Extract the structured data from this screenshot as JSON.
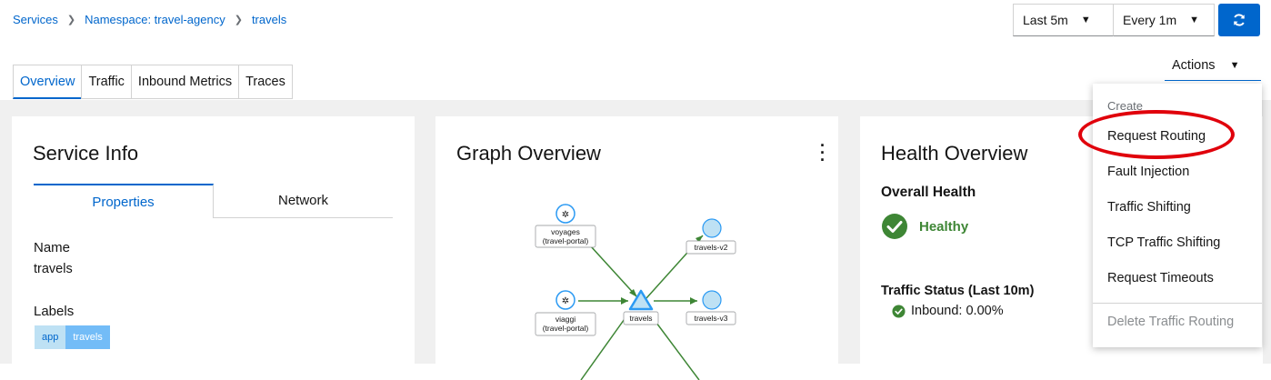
{
  "breadcrumb": {
    "items": [
      "Services",
      "Namespace: travel-agency",
      "travels"
    ]
  },
  "time_controls": {
    "range": "Last 5m",
    "refresh_interval": "Every 1m",
    "refresh_icon": "sync-icon"
  },
  "tabs": [
    "Overview",
    "Traffic",
    "Inbound Metrics",
    "Traces"
  ],
  "actions": {
    "label": "Actions",
    "menu": {
      "group": "Create",
      "items": [
        "Request Routing",
        "Fault Injection",
        "Traffic Shifting",
        "TCP Traffic Shifting",
        "Request Timeouts"
      ],
      "disabled_item": "Delete Traffic Routing"
    }
  },
  "service_info": {
    "title": "Service Info",
    "tabs": [
      "Properties",
      "Network"
    ],
    "name_label": "Name",
    "name_value": "travels",
    "labels_label": "Labels",
    "label_key": "app",
    "label_value": "travels"
  },
  "graph_overview": {
    "title": "Graph Overview",
    "nodes": {
      "voyages": [
        "voyages",
        "(travel-portal)"
      ],
      "viaggi": [
        "viaggi",
        "(travel-portal)"
      ],
      "travels": "travels",
      "travels_v2": "travels-v2",
      "travels_v3": "travels-v3"
    }
  },
  "health_overview": {
    "title": "Health Overview",
    "overall_label": "Overall Health",
    "status": "Healthy",
    "traffic_status_label": "Traffic Status (Last 10m)",
    "inbound": "Inbound: 0.00%"
  },
  "colors": {
    "accent": "#0066cc",
    "healthy": "#3e8635",
    "highlight": "#e0000b"
  }
}
